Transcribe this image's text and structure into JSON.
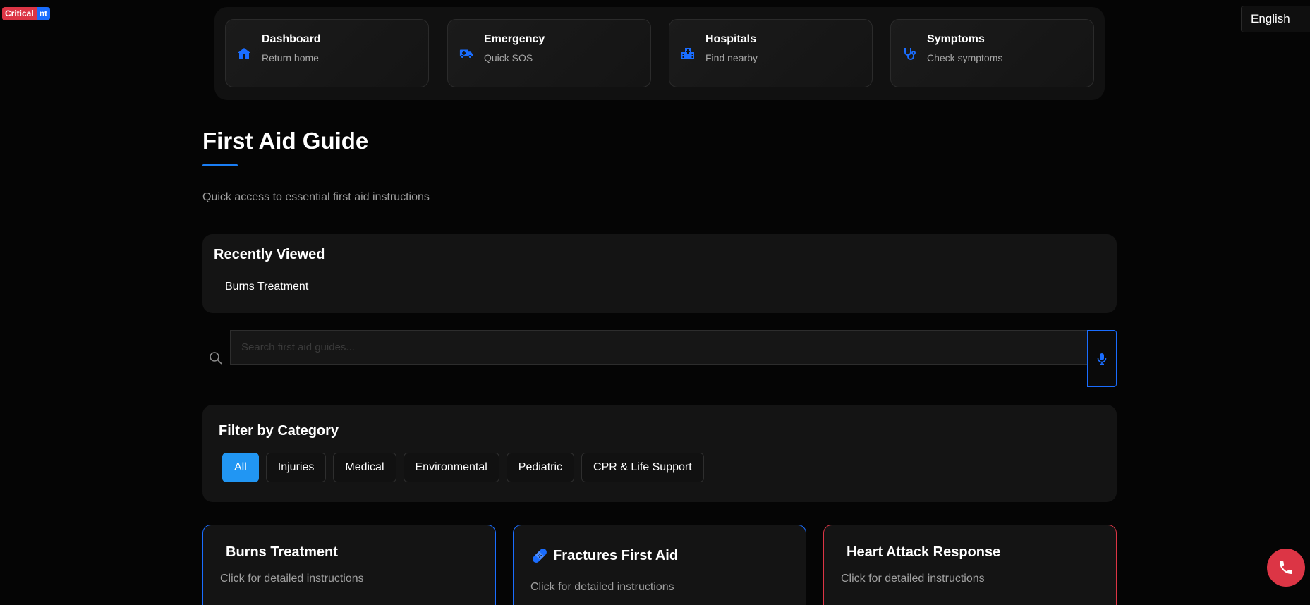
{
  "badge": {
    "critical": "Critical",
    "hidden": "nt"
  },
  "language": {
    "selected": "English"
  },
  "quick_nav": [
    {
      "title": "Dashboard",
      "subtitle": "Return home",
      "icon": "home-icon"
    },
    {
      "title": "Emergency",
      "subtitle": "Quick SOS",
      "icon": "ambulance-icon"
    },
    {
      "title": "Hospitals",
      "subtitle": "Find nearby",
      "icon": "hospital-icon"
    },
    {
      "title": "Symptoms",
      "subtitle": "Check symptoms",
      "icon": "stethoscope-icon"
    }
  ],
  "header": {
    "title": "First Aid Guide",
    "subtitle": "Quick access to essential first aid instructions"
  },
  "recently_viewed": {
    "heading": "Recently Viewed",
    "items": [
      "Burns Treatment"
    ]
  },
  "search": {
    "placeholder": "Search first aid guides...",
    "value": ""
  },
  "filter": {
    "heading": "Filter by Category",
    "categories": [
      "All",
      "Injuries",
      "Medical",
      "Environmental",
      "Pediatric",
      "CPR & Life Support"
    ],
    "active": "All"
  },
  "guides": [
    {
      "title": "Burns Treatment",
      "description": "Click for detailed instructions",
      "icon": ""
    },
    {
      "title": "Fractures First Aid",
      "description": "Click for detailed instructions",
      "icon": "bandage-icon"
    },
    {
      "title": "Heart Attack Response",
      "description": "Click for detailed instructions",
      "icon": ""
    }
  ],
  "colors": {
    "accent": "#1a6dff",
    "active_chip": "#2196f3",
    "critical": "#dc3545",
    "background": "#050505",
    "panel": "#141414"
  }
}
